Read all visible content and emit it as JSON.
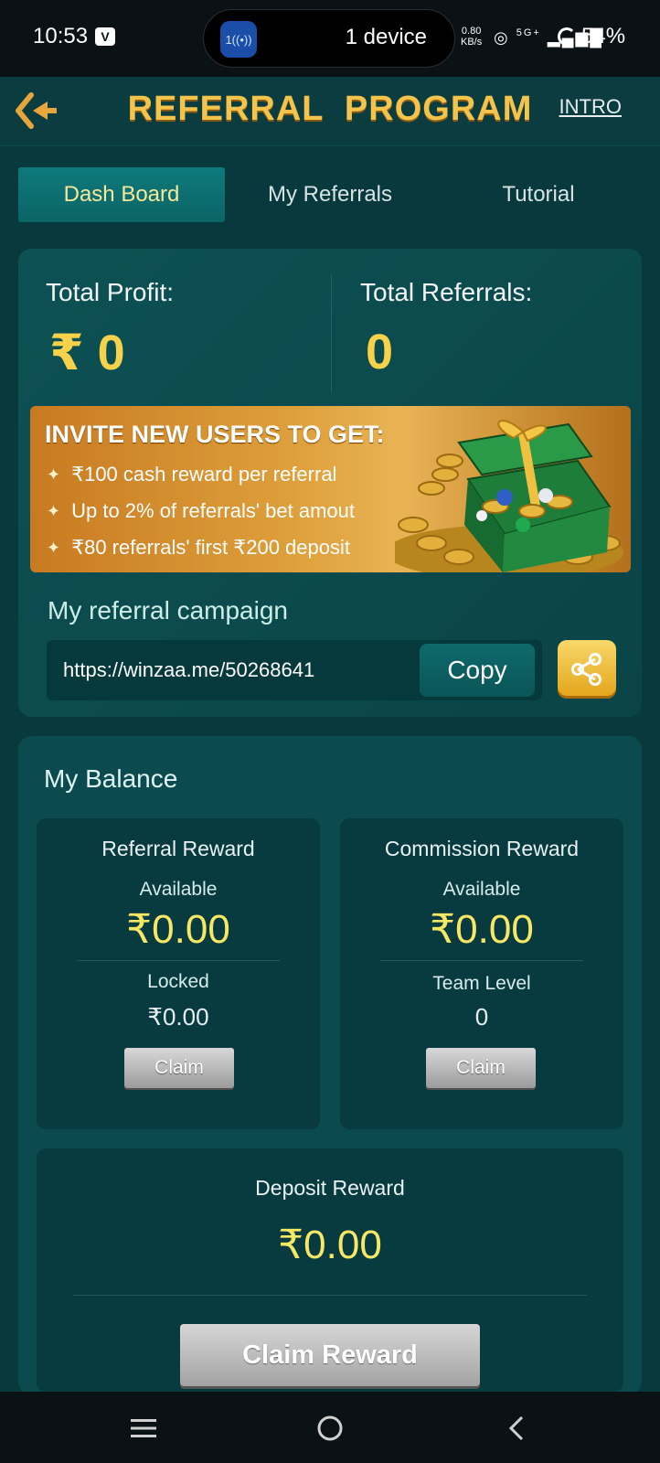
{
  "status_bar": {
    "time": "10:53",
    "app_badge": "V",
    "device_pill_icon": "1",
    "device_pill_text": "1 device",
    "net_speed_value": "0.80",
    "net_speed_unit": "KB/s",
    "network": "5G+",
    "battery": "54%"
  },
  "header": {
    "title": "REFERRAL  PROGRAM",
    "intro_link": "INTRO"
  },
  "tabs": [
    {
      "label": "Dash Board",
      "active": true
    },
    {
      "label": "My Referrals",
      "active": false
    },
    {
      "label": "Tutorial",
      "active": false
    }
  ],
  "summary": {
    "total_profit_label": "Total Profit:",
    "total_profit_value": "₹ 0",
    "total_referrals_label": "Total Referrals:",
    "total_referrals_value": "0"
  },
  "banner": {
    "title": "INVITE NEW USERS TO GET:",
    "items": [
      "₹100  cash reward per referral",
      "Up to 2% of referrals' bet amout",
      "₹80 referrals' first ₹200 deposit"
    ]
  },
  "campaign": {
    "label": "My referral campaign",
    "link": "https://winzaa.me/50268641",
    "copy_label": "Copy"
  },
  "balance": {
    "title": "My Balance",
    "referral_reward": {
      "title": "Referral Reward",
      "available_label": "Available",
      "available_value": "₹0.00",
      "locked_label": "Locked",
      "locked_value": "₹0.00",
      "claim_label": "Claim"
    },
    "commission_reward": {
      "title": "Commission Reward",
      "available_label": "Available",
      "available_value": "₹0.00",
      "team_level_label": "Team Level",
      "team_level_value": "0",
      "claim_label": "Claim"
    },
    "deposit_reward": {
      "title": "Deposit Reward",
      "value": "₹0.00",
      "claim_label": "Claim Reward"
    }
  },
  "colors": {
    "background": "#07393d",
    "accent_gold": "#f3c34b",
    "amount_yellow": "#f6e865"
  }
}
